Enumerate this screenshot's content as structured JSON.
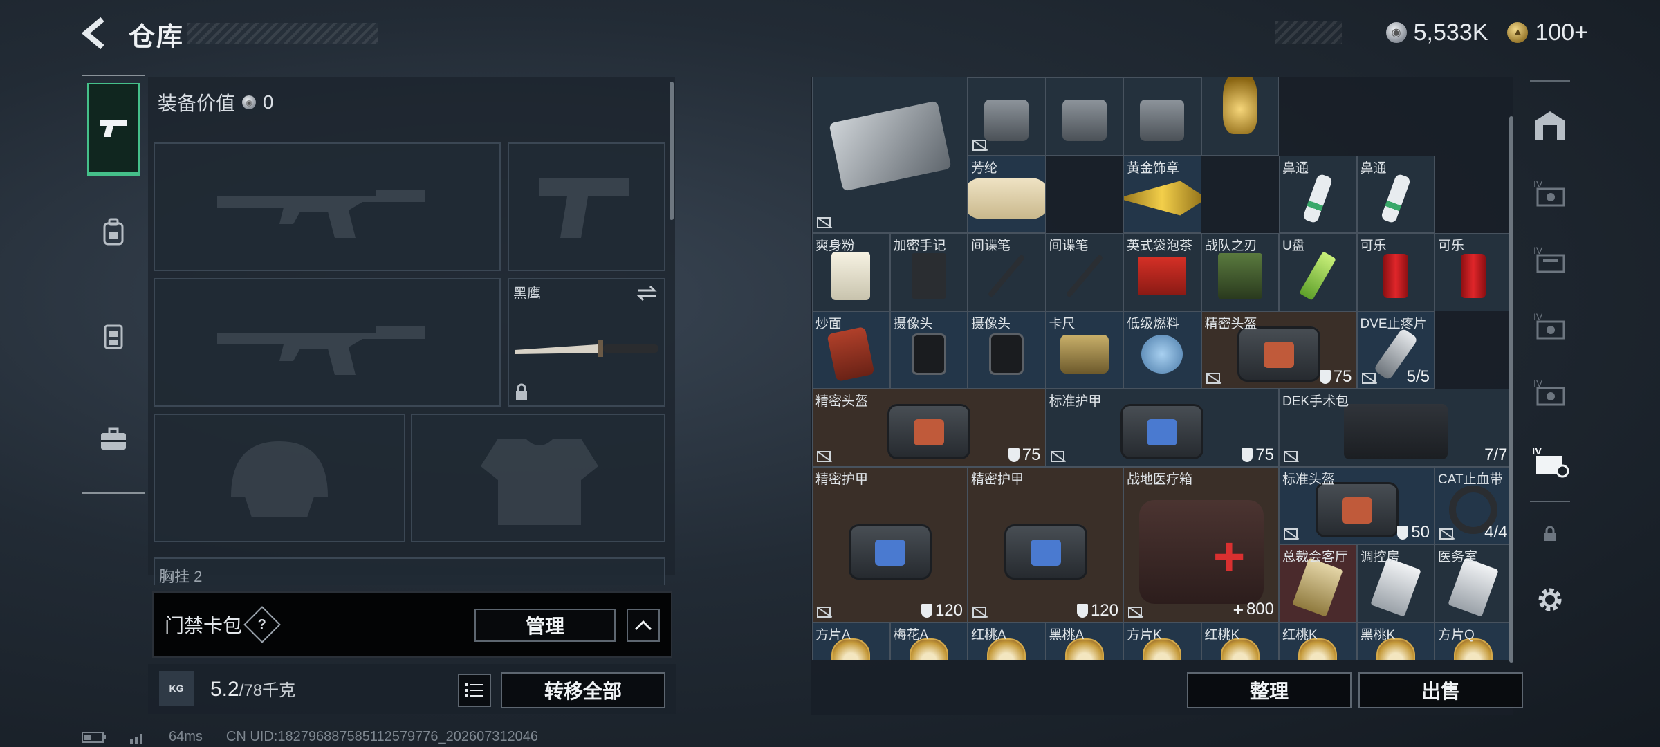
{
  "header": {
    "title": "仓库"
  },
  "currency": {
    "silver": "5,533K",
    "gold": "100+"
  },
  "left_nav": {
    "tabs": [
      {
        "id": "weapon",
        "icon": "pistol-icon",
        "active": true
      },
      {
        "id": "backpack",
        "icon": "backpack-icon",
        "active": false
      },
      {
        "id": "vest",
        "icon": "rig-icon",
        "active": false
      },
      {
        "id": "case",
        "icon": "briefcase-icon",
        "active": false
      }
    ]
  },
  "equipment": {
    "value_label": "装备价值",
    "value": "0",
    "melee_label": "黑鹰",
    "chest_label": "胸挂",
    "chest_count": "2"
  },
  "card_pack": {
    "label": "门禁卡包",
    "help": "?",
    "manage": "管理"
  },
  "weight": {
    "unit_icon": "KG",
    "current": "5.2",
    "max": "/78千克"
  },
  "transfer_all": "转移全部",
  "inventory": {
    "sort": "整理",
    "sell": "出售",
    "items": [
      {
        "name": "",
        "type": "toolbox",
        "stat": ""
      },
      {
        "name": "",
        "type": "generic",
        "stat": ""
      },
      {
        "name": "",
        "type": "generic",
        "stat": ""
      },
      {
        "name": "",
        "type": "generic",
        "stat": ""
      },
      {
        "name": "",
        "type": "vase",
        "stat": ""
      },
      {
        "name": "芳纶",
        "type": "paper",
        "stat": ""
      },
      {
        "name": "黄金饰章",
        "type": "badge-gold",
        "stat": ""
      },
      {
        "name": "鼻通",
        "type": "stick",
        "stat": ""
      },
      {
        "name": "鼻通",
        "type": "stick",
        "stat": ""
      },
      {
        "name": "爽身粉",
        "type": "tin",
        "stat": ""
      },
      {
        "name": "加密手记",
        "type": "notebook",
        "stat": ""
      },
      {
        "name": "间谍笔",
        "type": "pen",
        "stat": ""
      },
      {
        "name": "间谍笔",
        "type": "pen",
        "stat": ""
      },
      {
        "name": "英式袋泡茶",
        "type": "redbox",
        "stat": ""
      },
      {
        "name": "战队之刃",
        "type": "book",
        "stat": ""
      },
      {
        "name": "U盘",
        "type": "usb",
        "stat": ""
      },
      {
        "name": "可乐",
        "type": "can",
        "stat": ""
      },
      {
        "name": "可乐",
        "type": "can",
        "stat": ""
      },
      {
        "name": "炒面",
        "type": "bag-food",
        "stat": ""
      },
      {
        "name": "摄像头",
        "type": "cam",
        "stat": ""
      },
      {
        "name": "摄像头",
        "type": "cam",
        "stat": ""
      },
      {
        "name": "卡尺",
        "type": "tape",
        "stat": ""
      },
      {
        "name": "低级燃料",
        "type": "burner",
        "stat": ""
      },
      {
        "name": "精密头盔",
        "type": "bag",
        "stat": "75"
      },
      {
        "name": "DVE止疼片",
        "type": "injector",
        "stat": "5/5"
      },
      {
        "name": "精密头盔",
        "type": "bag",
        "stat": "75"
      },
      {
        "name": "标准护甲",
        "type": "bag",
        "stat": "75"
      },
      {
        "name": "DEK手术包",
        "type": "case",
        "stat": "7/7"
      },
      {
        "name": "精密护甲",
        "type": "bag",
        "stat": "120"
      },
      {
        "name": "精密护甲",
        "type": "bag",
        "stat": "120"
      },
      {
        "name": "战地医疗箱",
        "type": "medkit",
        "stat": "800"
      },
      {
        "name": "标准头盔",
        "type": "bag",
        "stat": "50"
      },
      {
        "name": "CAT止血带",
        "type": "tourniquet",
        "stat": "4/4"
      },
      {
        "name": "总裁会客厅",
        "type": "keycard",
        "stat": ""
      },
      {
        "name": "调控房",
        "type": "keycard",
        "stat": ""
      },
      {
        "name": "医务室",
        "type": "keycard",
        "stat": ""
      },
      {
        "name": "方片A",
        "type": "card",
        "stat": ""
      },
      {
        "name": "梅花A",
        "type": "card",
        "stat": ""
      },
      {
        "name": "红桃A",
        "type": "card",
        "stat": ""
      },
      {
        "name": "黑桃A",
        "type": "card",
        "stat": ""
      },
      {
        "name": "方片K",
        "type": "card",
        "stat": ""
      },
      {
        "name": "红桃K",
        "type": "card",
        "stat": ""
      },
      {
        "name": "红桃K",
        "type": "card",
        "stat": ""
      },
      {
        "name": "黑桃K",
        "type": "card",
        "stat": ""
      },
      {
        "name": "方片Q",
        "type": "card",
        "stat": ""
      }
    ]
  },
  "status": {
    "ping": "64ms",
    "uid": "CN UID:182796887585112579776_202607312046"
  }
}
